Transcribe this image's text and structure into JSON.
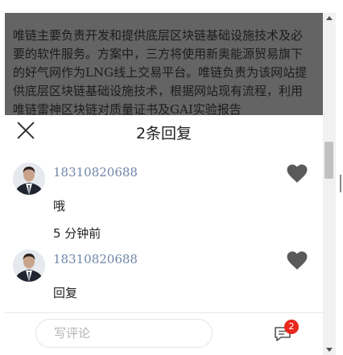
{
  "article": {
    "text": "唯链主要负责开发和提供底层区块链基础设施技术及必要的软件服务。方案中，三方将使用新奥能源贸易旗下的好气网作为LNG线上交易平台。唯链负责为该网站提供底层区块链基础设施技术，根据网站现有流程，利用唯链雷神区块链对质量证书及GAI实验报告"
  },
  "sheet": {
    "title": "2条回复"
  },
  "comments": [
    {
      "username": "18310820688",
      "content": "哦",
      "time": "5 分钟前"
    },
    {
      "username": "18310820688",
      "content": "回复"
    }
  ],
  "footer": {
    "input_placeholder": "写评论",
    "badge_count": "2"
  },
  "colors": {
    "username": "#6f86a8",
    "overlay": "#646464",
    "badge": "#e8281d",
    "heart": "#5a5a5a"
  },
  "icons": [
    "close-icon",
    "heart-icon",
    "chat-icon",
    "avatar-photo"
  ]
}
